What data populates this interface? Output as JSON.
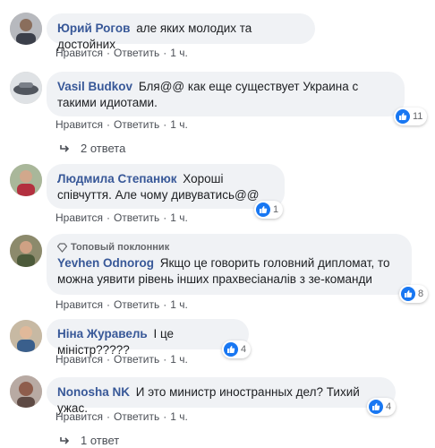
{
  "actions": {
    "like": "Нравится",
    "reply": "Ответить",
    "sep": "·"
  },
  "comments": [
    {
      "author": "Юрий Рогов",
      "text": "але яких молодих та достойних",
      "time": "1 ч."
    },
    {
      "author": "Vasil Budkov",
      "text": "Бля@@ как еще существует Украина с такими идиотами.",
      "time": "1 ч.",
      "reactions": "11",
      "replies": "2 ответа"
    },
    {
      "author": "Людмила Степанюк",
      "text": "Хороші співчуття. Але чому дивуватись@@",
      "time": "1 ч.",
      "reactions": "1"
    },
    {
      "author": "Yevhen Odnorog",
      "badge": "Топовый поклонник",
      "text": "Якщо це говорить головний дипломат, то можна уявити рівень інших прахвесіаналів з зе-команди",
      "time": "1 ч.",
      "reactions": "8"
    },
    {
      "author": "Ніна Журавель",
      "text": "І це міністр?????",
      "time": "1 ч.",
      "reactions": "4"
    },
    {
      "author": "Nonosha NK",
      "text": "И это министр иностранных дел? Тихий ужас.",
      "time": "1 ч.",
      "reactions": "4",
      "replies": "1 ответ"
    }
  ],
  "colors": {
    "author": "#385898",
    "bubble": "#f0f2f5",
    "like": "#1877f2"
  },
  "icons": {
    "like": "thumbs-up-icon",
    "reply_arrow": "reply-arrow-icon",
    "badge": "diamond-icon"
  }
}
